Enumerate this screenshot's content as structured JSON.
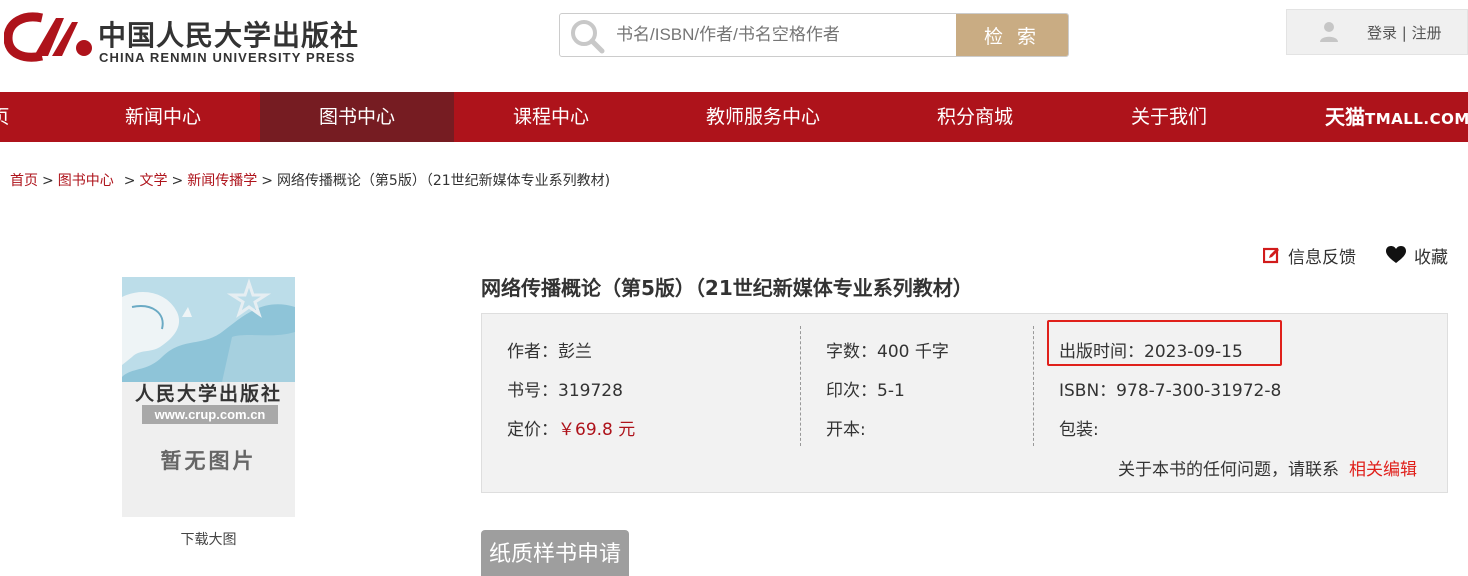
{
  "header": {
    "logo_cn": "中国人民大学出版社",
    "logo_en": "CHINA RENMIN UNIVERSITY PRESS",
    "search_placeholder": "书名/ISBN/作者/书名空格作者",
    "search_button": "检 索",
    "login": "登录",
    "login_sep": " | ",
    "register": "注册"
  },
  "nav": {
    "items": [
      {
        "label": "页"
      },
      {
        "label": "新闻中心"
      },
      {
        "label": "图书中心"
      },
      {
        "label": "课程中心"
      },
      {
        "label": "教师服务中心"
      },
      {
        "label": "积分商城"
      },
      {
        "label": "关于我们"
      }
    ],
    "tmall_cn": "天猫",
    "tmall_en": "TMALL.COM",
    "active": "图书中心"
  },
  "breadcrumb": {
    "items": [
      "首页",
      "图书中心",
      "文学",
      "新闻传播学"
    ],
    "current": "网络传播概论（第5版）（21世纪新媒体专业系列教材)"
  },
  "cover": {
    "press_name": "人民大学出版社",
    "url": "www.crup.com.cn",
    "no_image": "暂无图片",
    "download": "下载大图"
  },
  "actions": {
    "feedback": "信息反馈",
    "favorite": "收藏"
  },
  "book": {
    "title": "网络传播概论（第5版）（21世纪新媒体专业系列教材）",
    "author": "作者：彭兰",
    "book_no": "书号：319728",
    "price_label": "定价：",
    "price_value": "￥69.8 元",
    "word_count": "字数：400 千字",
    "print": "印次：5-1",
    "format": "开本:",
    "pub_date": "出版时间：2023-09-15",
    "isbn": "ISBN：978-7-300-31972-8",
    "binding": "包装:",
    "contact_text": "关于本书的任何问题，请联系",
    "contact_link": "相关编辑"
  },
  "sample_button": "纸质样书申请",
  "colors": {
    "brand_red": "#ae131b",
    "active_nav": "#761c22",
    "search_button": "#c9ac83",
    "highlight_border": "#e0201b"
  }
}
